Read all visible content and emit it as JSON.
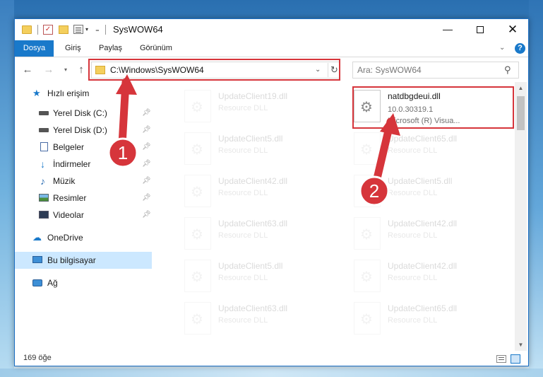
{
  "window": {
    "title": "SysWOW64",
    "controls": {
      "minimize": "—",
      "close": "✕"
    }
  },
  "ribbon": {
    "tabs": [
      "Dosya",
      "Giriş",
      "Paylaş",
      "Görünüm"
    ],
    "help": "?"
  },
  "address": {
    "path": "C:\\Windows\\SysWOW64"
  },
  "search": {
    "placeholder": "Ara: SysWOW64"
  },
  "sidebar": {
    "items": [
      {
        "label": "Hızlı erişim",
        "icon": "star-icon"
      },
      {
        "label": "Yerel Disk (C:)",
        "icon": "drive-icon",
        "pinned": true
      },
      {
        "label": "Yerel Disk (D:)",
        "icon": "drive-icon",
        "pinned": true
      },
      {
        "label": "Belgeler",
        "icon": "documents-icon",
        "pinned": true
      },
      {
        "label": "İndirmeler",
        "icon": "download-icon",
        "pinned": true
      },
      {
        "label": "Müzik",
        "icon": "music-icon",
        "pinned": true
      },
      {
        "label": "Resimler",
        "icon": "pictures-icon",
        "pinned": true
      },
      {
        "label": "Videolar",
        "icon": "videos-icon",
        "pinned": true
      },
      {
        "label": "OneDrive",
        "icon": "cloud-icon"
      },
      {
        "label": "Bu bilgisayar",
        "icon": "computer-icon",
        "selected": true
      },
      {
        "label": "Ağ",
        "icon": "network-icon"
      }
    ]
  },
  "files": {
    "left": [
      {
        "name": "UpdateClient19.dll",
        "type": "Resource DLL"
      },
      {
        "name": "UpdateClient5.dll",
        "type": "Resource DLL"
      },
      {
        "name": "UpdateClient42.dll",
        "type": "Resource DLL"
      },
      {
        "name": "UpdateClient63.dll",
        "type": "Resource DLL"
      },
      {
        "name": "UpdateClient5.dll",
        "type": "Resource DLL"
      },
      {
        "name": "UpdateClient63.dll",
        "type": "Resource DLL"
      }
    ],
    "right": [
      {
        "name": "natdbgdeui.dll",
        "version": "10.0.30319.1",
        "description": "Microsoft (R) Visua..."
      },
      {
        "name": "UpdateClient65.dll",
        "type": "Resource DLL"
      },
      {
        "name": "UpdateClient5.dll",
        "type": "Resource DLL"
      },
      {
        "name": "UpdateClient42.dll",
        "type": "Resource DLL"
      },
      {
        "name": "UpdateClient42.dll",
        "type": "Resource DLL"
      },
      {
        "name": "UpdateClient65.dll",
        "type": "Resource DLL"
      }
    ]
  },
  "status": {
    "item_count": "169 öğe"
  },
  "annotations": {
    "step1": "1",
    "step2": "2",
    "color": "#d6353b"
  },
  "colors": {
    "accent": "#1979ca",
    "highlight": "#d6353b",
    "selected": "#cce8ff"
  }
}
